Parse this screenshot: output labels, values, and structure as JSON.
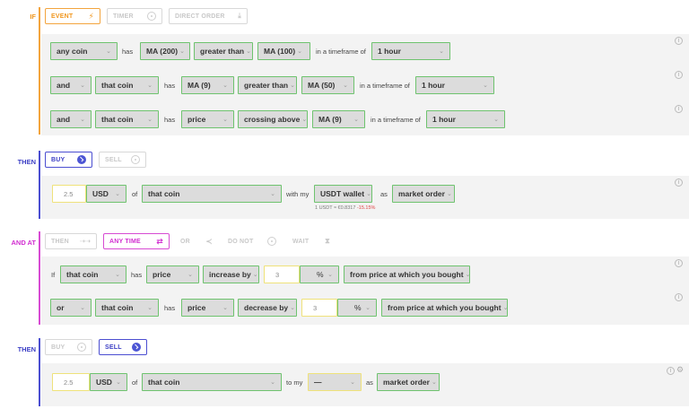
{
  "sections": {
    "if_label": "IF",
    "then1_label": "THEN",
    "andat_label": "AND AT",
    "then2_label": "THEN"
  },
  "trigger_tabs": {
    "event": "EVENT",
    "timer": "TIMER",
    "direct_order": "DIRECT ORDER"
  },
  "conditions": {
    "row1": {
      "subject": "any coin",
      "has": "has",
      "ind1": "MA (200)",
      "op": "greater than",
      "ind2": "MA (100)",
      "tf_text": "in a timeframe of",
      "tf": "1 hour"
    },
    "row2": {
      "join": "and",
      "subject": "that coin",
      "has": "has",
      "ind1": "MA (9)",
      "op": "greater than",
      "ind2": "MA (50)",
      "tf_text": "in a timeframe of",
      "tf": "1 hour"
    },
    "row3": {
      "join": "and",
      "subject": "that coin",
      "has": "has",
      "ind1": "price",
      "op": "crossing above",
      "ind2": "MA (9)",
      "tf_text": "in a timeframe of",
      "tf": "1 hour"
    }
  },
  "buy_tabs": {
    "buy": "BUY",
    "sell": "SELL"
  },
  "buy_row": {
    "amount_placeholder": "2.5",
    "currency": "USD",
    "of": "of",
    "coin": "that coin",
    "with_my": "with my",
    "wallet": "USDT wallet",
    "as": "as",
    "order": "market order",
    "rate_prefix": "1 USDT ≈ €0.8317",
    "rate_change": "-15.15%"
  },
  "andat_tabs": {
    "then": "THEN",
    "any_time": "ANY TIME",
    "or": "OR",
    "do_not": "DO NOT",
    "wait": "WAIT"
  },
  "exit_conditions": {
    "row1": {
      "if": "If",
      "subject": "that coin",
      "has": "has",
      "ind": "price",
      "op": "increase by",
      "value": "3",
      "unit": "%",
      "tail": "from price at which you bought"
    },
    "row2": {
      "join": "or",
      "subject": "that coin",
      "has": "has",
      "ind": "price",
      "op": "decrease by",
      "value": "3",
      "unit": "%",
      "tail": "from price at which you bought"
    }
  },
  "sell_tabs": {
    "buy": "BUY",
    "sell": "SELL"
  },
  "sell_row": {
    "amount_placeholder": "2.5",
    "currency": "USD",
    "of": "of",
    "coin": "that coin",
    "to_my": "to my",
    "wallet": "—",
    "as": "as",
    "order": "market order"
  },
  "colors": {
    "if_orange": "#f3a43d",
    "then_blue": "#4b4ed1",
    "andat_pink": "#d74bd3",
    "select_border_green": "#6ec36e",
    "input_border_yellow": "#efe27a"
  }
}
